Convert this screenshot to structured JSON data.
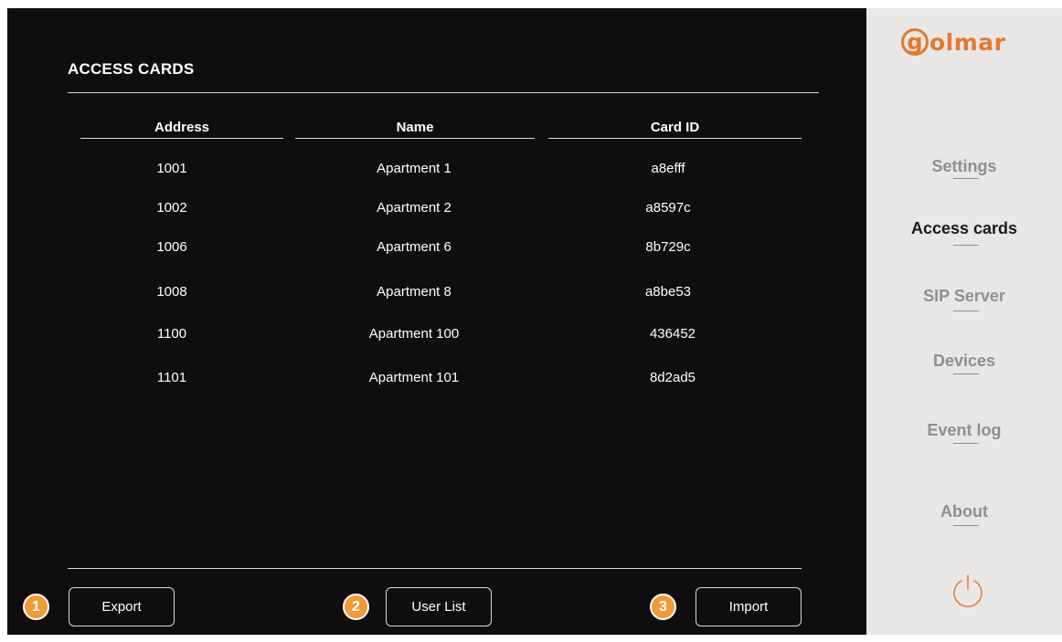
{
  "page": {
    "title": "ACCESS CARDS"
  },
  "table": {
    "headers": {
      "address": "Address",
      "name": "Name",
      "card_id": "Card ID"
    },
    "rows": [
      {
        "address": "1001",
        "name": "Apartment 1",
        "card_id": "a8efff"
      },
      {
        "address": "1002",
        "name": "Apartment 2",
        "card_id": "a8597c"
      },
      {
        "address": "1006",
        "name": "Apartment 6",
        "card_id": "8b729c"
      },
      {
        "address": "1008",
        "name": "Apartment 8",
        "card_id": "a8be53"
      },
      {
        "address": "1100",
        "name": "Apartment 100",
        "card_id": "436452"
      },
      {
        "address": "1101",
        "name": "Apartment 101",
        "card_id": "8d2ad5"
      }
    ]
  },
  "buttons": {
    "export": {
      "label": "Export",
      "badge": "1"
    },
    "user_list": {
      "label": "User List",
      "badge": "2"
    },
    "import": {
      "label": "Import",
      "badge": "3"
    }
  },
  "sidebar": {
    "logo": {
      "initial": "g",
      "rest": "olmar"
    },
    "items": [
      {
        "label": "Settings",
        "active": false
      },
      {
        "label": "Access cards",
        "active": true
      },
      {
        "label": "SIP Server",
        "active": false
      },
      {
        "label": "Devices",
        "active": false
      },
      {
        "label": "Event log",
        "active": false
      },
      {
        "label": "About",
        "active": false
      }
    ],
    "power_icon": "power-icon"
  },
  "colors": {
    "accent": "#f29a38",
    "logo": "#e7782b",
    "background": "#0f0d10",
    "sidebar": "#e8e7e6"
  }
}
